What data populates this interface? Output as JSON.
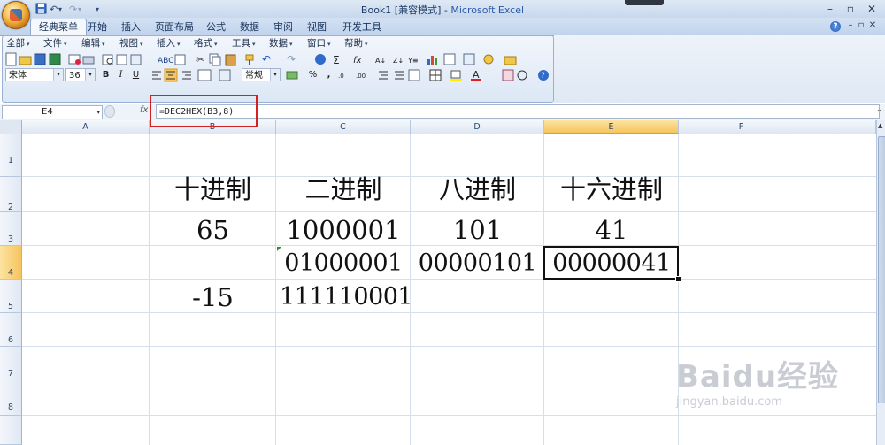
{
  "window": {
    "title": "Book1",
    "mode": "[兼容模式]",
    "app": "Microsoft Excel",
    "controls": [
      "–",
      "▫",
      "✕"
    ]
  },
  "quick_access": {
    "undo": "↶",
    "redo": "↷",
    "more": "▾"
  },
  "tabs": [
    "经典菜单",
    "开始",
    "插入",
    "页面布局",
    "公式",
    "数据",
    "审阅",
    "视图",
    "开发工具"
  ],
  "active_tab": "经典菜单",
  "classic_menu": [
    "全部",
    "文件",
    "编辑",
    "视图",
    "插入",
    "格式",
    "工具",
    "数据",
    "窗口",
    "帮助"
  ],
  "formatting": {
    "font_name": "宋体",
    "font_size": "36",
    "bold": "B",
    "italic": "I",
    "underline": "U",
    "number_format": "常规",
    "percent": "%",
    "comma": ","
  },
  "formula_bar": {
    "name_box": "E4",
    "fx": "fx",
    "formula": "=DEC2HEX(B3,8)"
  },
  "columns": [
    "A",
    "B",
    "C",
    "D",
    "E",
    "F"
  ],
  "rows": [
    "1",
    "2",
    "3",
    "4",
    "5",
    "6",
    "7",
    "8"
  ],
  "selected_cell": {
    "column": "E",
    "row": "4"
  },
  "cells": {
    "B2": "十进制",
    "C2": "二进制",
    "D2": "八进制",
    "E2": "十六进制",
    "B3": "65",
    "C3": "1000001",
    "D3": "101",
    "E3": "41",
    "C4": "01000001",
    "D4": "00000101",
    "E4": "00000041",
    "B5": "-15",
    "C5": "111110001"
  },
  "watermark": {
    "logo": "Baidu经验",
    "url": "jingyan.baidu.com"
  },
  "colors": {
    "selection_header": "#f7c45e",
    "highlight_box": "#d42020",
    "ribbon": "#dce7f5"
  }
}
